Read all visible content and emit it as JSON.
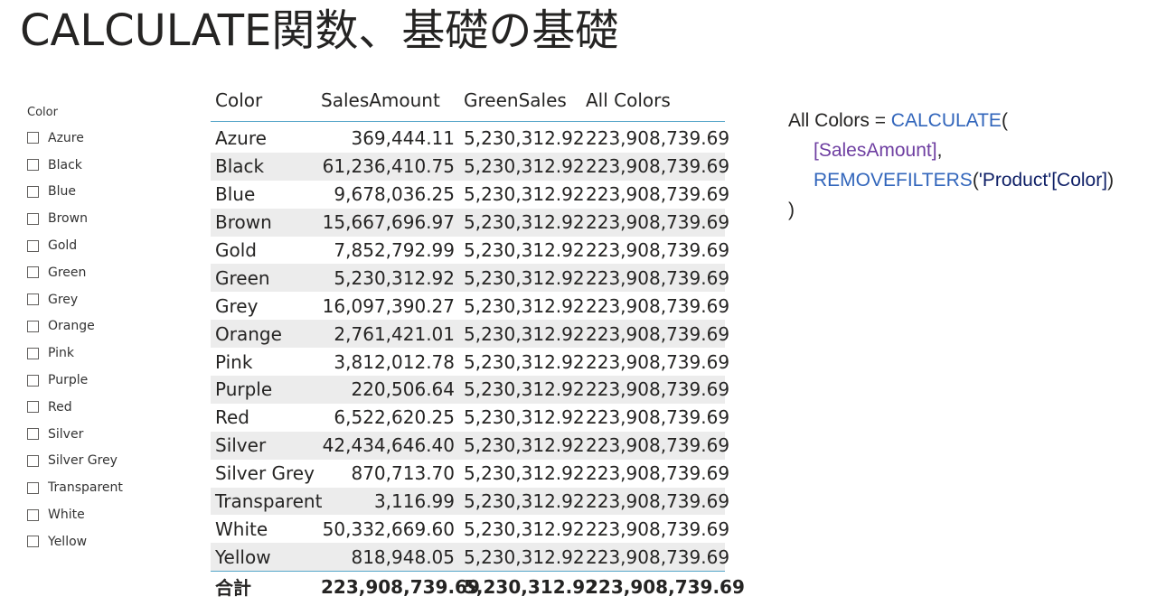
{
  "page_title": "CALCULATE関数、基礎の基礎",
  "slicer": {
    "header": "Color",
    "items": [
      "Azure",
      "Black",
      "Blue",
      "Brown",
      "Gold",
      "Green",
      "Grey",
      "Orange",
      "Pink",
      "Purple",
      "Red",
      "Silver",
      "Silver Grey",
      "Transparent",
      "White",
      "Yellow"
    ]
  },
  "table": {
    "columns": [
      "Color",
      "SalesAmount",
      "GreenSales",
      "All Colors"
    ],
    "rows": [
      [
        "Azure",
        "369,444.11",
        "5,230,312.92",
        "223,908,739.69"
      ],
      [
        "Black",
        "61,236,410.75",
        "5,230,312.92",
        "223,908,739.69"
      ],
      [
        "Blue",
        "9,678,036.25",
        "5,230,312.92",
        "223,908,739.69"
      ],
      [
        "Brown",
        "15,667,696.97",
        "5,230,312.92",
        "223,908,739.69"
      ],
      [
        "Gold",
        "7,852,792.99",
        "5,230,312.92",
        "223,908,739.69"
      ],
      [
        "Green",
        "5,230,312.92",
        "5,230,312.92",
        "223,908,739.69"
      ],
      [
        "Grey",
        "16,097,390.27",
        "5,230,312.92",
        "223,908,739.69"
      ],
      [
        "Orange",
        "2,761,421.01",
        "5,230,312.92",
        "223,908,739.69"
      ],
      [
        "Pink",
        "3,812,012.78",
        "5,230,312.92",
        "223,908,739.69"
      ],
      [
        "Purple",
        "220,506.64",
        "5,230,312.92",
        "223,908,739.69"
      ],
      [
        "Red",
        "6,522,620.25",
        "5,230,312.92",
        "223,908,739.69"
      ],
      [
        "Silver",
        "42,434,646.40",
        "5,230,312.92",
        "223,908,739.69"
      ],
      [
        "Silver Grey",
        "870,713.70",
        "5,230,312.92",
        "223,908,739.69"
      ],
      [
        "Transparent",
        "3,116.99",
        "5,230,312.92",
        "223,908,739.69"
      ],
      [
        "White",
        "50,332,669.60",
        "5,230,312.92",
        "223,908,739.69"
      ],
      [
        "Yellow",
        "818,948.05",
        "5,230,312.92",
        "223,908,739.69"
      ]
    ],
    "total": [
      "合計",
      "223,908,739.69",
      "5,230,312.92",
      "223,908,739.69"
    ]
  },
  "formula": {
    "line1_name": "All Colors = ",
    "line1_fn": "CALCULATE",
    "line1_paren": "(",
    "line2_measure": "[SalesAmount]",
    "line2_comma": ",",
    "line3_fn": "REMOVEFILTERS",
    "line3_open": "(",
    "line3_table": "'Product'",
    "line3_col": "[Color]",
    "line3_close": ")",
    "line4": ")"
  },
  "colors": {
    "header_rule": "#56a6c9",
    "row_band": "#ececec",
    "formula_function": "#3165bb",
    "formula_measure": "#6e3ea1",
    "formula_table": "#0e1f66"
  }
}
